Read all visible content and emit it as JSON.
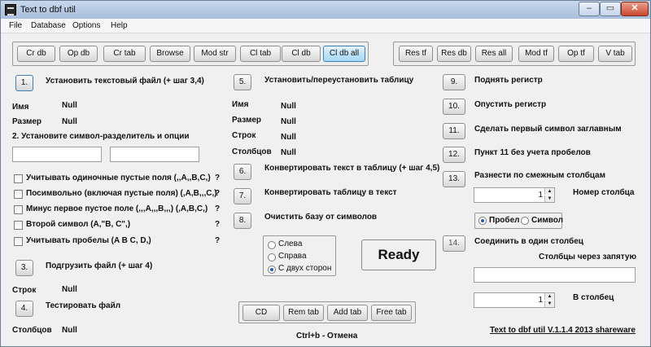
{
  "window": {
    "title": "Text to dbf util",
    "min": "–",
    "max": "▭",
    "close": "✕"
  },
  "menu": [
    "File",
    "Database",
    "Options",
    "Help"
  ],
  "toolbar_left": [
    "Cr db",
    "Op db",
    "Cr tab",
    "Browse",
    "Mod str",
    "Cl tab",
    "Cl db",
    "Cl db all"
  ],
  "toolbar_right": [
    "Res tf",
    "Res db",
    "Res all",
    "Mod tf",
    "Op tf",
    "V tab"
  ],
  "step1": {
    "num": "1.",
    "label": "Установить текстовый файл (+ шаг 3,4)"
  },
  "name_label": "Имя",
  "name_value": "Null",
  "size_label": "Размер",
  "size_value": "Null",
  "step2_label": "2. Установите символ-разделитель и опции",
  "options": [
    {
      "label": "Учитывать одиночные пустые поля (,,A,,B,C,)",
      "q": "?"
    },
    {
      "label": "Посимвольно (включая пустые поля) (,A,B,,,C,)",
      "q": "?"
    },
    {
      "label": "Минус первое пустое поле (,,,A,,,B,,,) (,A,B,C,)",
      "q": "?"
    },
    {
      "label": "Второй символ  (A,\"B, C\",)",
      "q": "?"
    },
    {
      "label": "Учитывать пробелы (A B C, D,)",
      "q": "?"
    }
  ],
  "step3": {
    "num": "3.",
    "label": "Подгрузить файл (+ шаг 4)"
  },
  "rows_label": "Строк",
  "rows_value": "Null",
  "step4": {
    "num": "4.",
    "label": "Тестировать файл"
  },
  "cols_label": "Столбцов",
  "cols_value": "Null",
  "step5": {
    "num": "5.",
    "label": "Установить/переустановить таблицу"
  },
  "t_name_label": "Имя",
  "t_name_value": "Null",
  "t_size_label": "Размер",
  "t_size_value": "Null",
  "t_rows_label": "Строк",
  "t_rows_value": "Null",
  "t_cols_label": "Столбцов",
  "t_cols_value": "Null",
  "step6": {
    "num": "6.",
    "label": "Конвертировать текст в таблицу (+ шаг 4,5)"
  },
  "step7": {
    "num": "7.",
    "label": "Конвертировать таблицу в текст"
  },
  "step8": {
    "num": "8.",
    "label": "Очистить базу от символов"
  },
  "trim_options": [
    "Слева",
    "Справа",
    "С двух сторон"
  ],
  "trim_selected": 2,
  "status": "Ready",
  "bottom_buttons": [
    "CD",
    "Rem tab",
    "Add tab",
    "Free tab"
  ],
  "cancel_hint": "Ctrl+b - Отмена",
  "step9": {
    "num": "9.",
    "label": "Поднять регистр"
  },
  "step10": {
    "num": "10.",
    "label": "Опустить регистр"
  },
  "step11": {
    "num": "11.",
    "label": "Сделать первый символ заглавным"
  },
  "step12": {
    "num": "12.",
    "label": "Пункт 11 без учета пробелов"
  },
  "step13": {
    "num": "13.",
    "label": "Разнести по смежным столбцам"
  },
  "col_spin_value": "1",
  "col_number_label": "Номер столбца",
  "sep_options": [
    "Пробел",
    "Символ"
  ],
  "sep_selected": 0,
  "step14": {
    "num": "14.",
    "label": "Соединить в один столбец"
  },
  "cols_comma_label": "Столбцы через запятую",
  "target_spin_value": "1",
  "target_label": "В столбец",
  "footer_link": "Text to dbf util  V.1.1.4 2013 shareware"
}
